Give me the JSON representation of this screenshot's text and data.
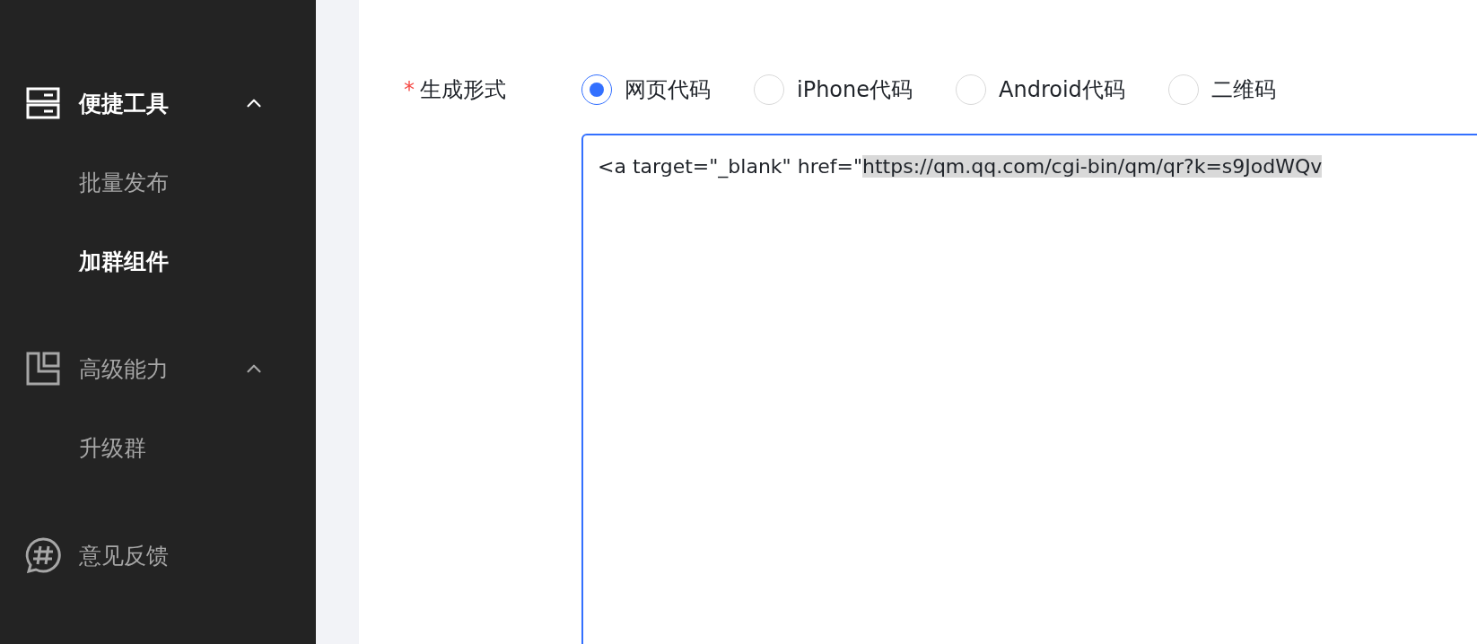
{
  "sidebar": {
    "items": [
      {
        "kind": "group",
        "label": "便捷工具",
        "expanded": true,
        "children": [
          {
            "label": "批量发布",
            "selected": false
          },
          {
            "label": "加群组件",
            "selected": true
          }
        ]
      },
      {
        "kind": "group",
        "label": "高级能力",
        "expanded": true,
        "children": [
          {
            "label": "升级群",
            "selected": false
          }
        ]
      },
      {
        "kind": "link",
        "label": "意见反馈",
        "selected": false
      }
    ]
  },
  "main": {
    "form": {
      "label": "生成形式",
      "required_mark": "*",
      "options": [
        {
          "label": "网页代码",
          "selected": true
        },
        {
          "label": "iPhone代码",
          "selected": false
        },
        {
          "label": "Android代码",
          "selected": false
        },
        {
          "label": "二维码",
          "selected": false
        }
      ],
      "code": {
        "text": "<a target=\"_blank\" href=\"",
        "selected_text": "https://qm.qq.com/cgi-bin/qm/qr?k=s9JodWQv"
      }
    }
  }
}
